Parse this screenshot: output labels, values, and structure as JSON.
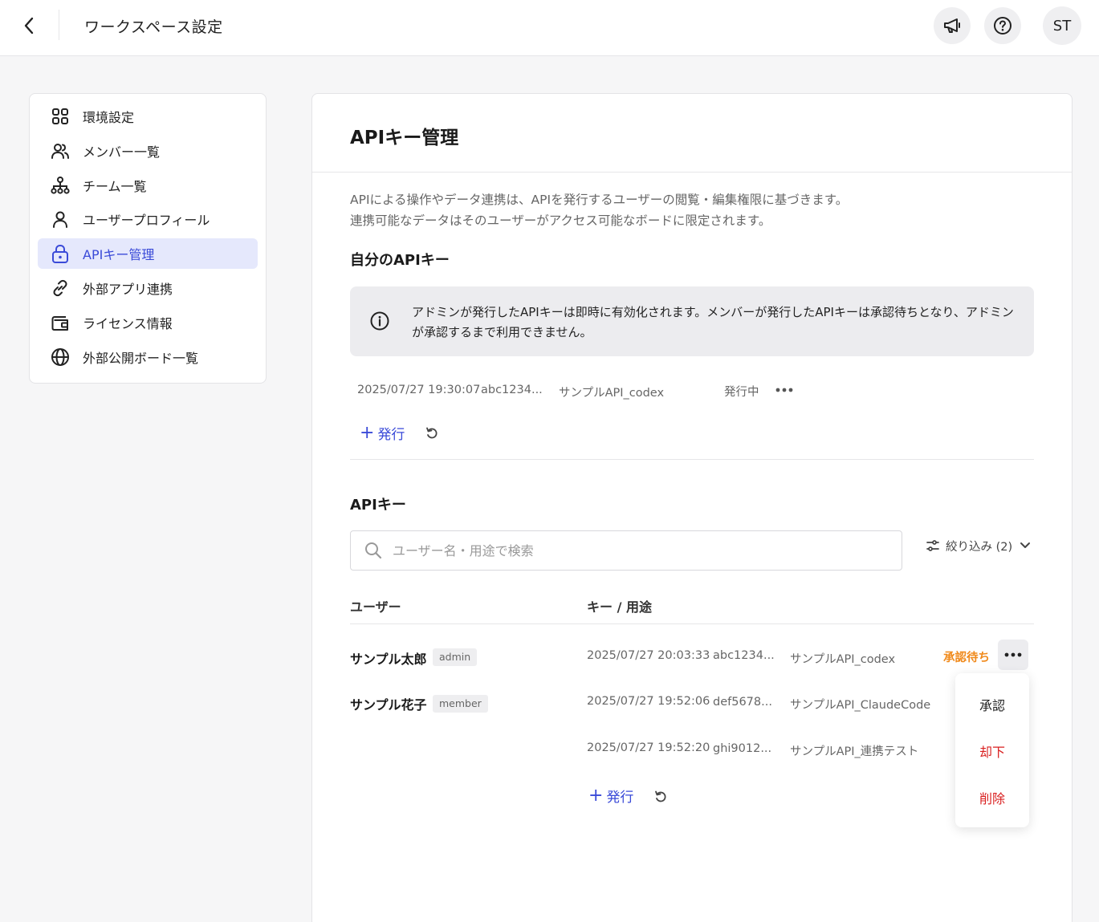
{
  "header": {
    "title": "ワークスペース設定",
    "avatar_initials": "ST"
  },
  "sidebar": {
    "items": [
      {
        "label": "環境設定",
        "icon": "grid-icon"
      },
      {
        "label": "メンバー一覧",
        "icon": "users-icon"
      },
      {
        "label": "チーム一覧",
        "icon": "hierarchy-icon"
      },
      {
        "label": "ユーザープロフィール",
        "icon": "user-icon"
      },
      {
        "label": "APIキー管理",
        "icon": "lock-icon",
        "active": true
      },
      {
        "label": "外部アプリ連携",
        "icon": "link-icon"
      },
      {
        "label": "ライセンス情報",
        "icon": "wallet-icon"
      },
      {
        "label": "外部公開ボード一覧",
        "icon": "globe-icon"
      }
    ]
  },
  "main": {
    "title": "APIキー管理",
    "description_line1": "APIによる操作やデータ連携は、APIを発行するユーザーの閲覧・編集権限に基づきます。",
    "description_line2": "連携可能なデータはそのユーザーがアクセス可能なボードに限定されます。",
    "my_keys": {
      "title": "自分のAPIキー",
      "info": "アドミンが発行したAPIキーは即時に有効化されます。メンバーが発行したAPIキーは承認待ちとなり、アドミンが承認するまで利用できません。",
      "key": {
        "date": "2025/07/27 19:30:07",
        "key": "abc1234...",
        "purpose": "サンプルAPI_codex",
        "status": "発行中"
      },
      "issue_label": "発行"
    },
    "all_keys": {
      "title": "APIキー",
      "search_placeholder": "ユーザー名・用途で検索",
      "filter_label": "絞り込み (2)",
      "columns": {
        "user": "ユーザー",
        "key": "キー / 用途"
      },
      "rows": [
        {
          "user": "サンプル太郎",
          "role": "admin",
          "date": "2025/07/27 20:03:33",
          "key": "abc1234...",
          "purpose": "サンプルAPI_codex",
          "status": "承認待ち"
        },
        {
          "user": "サンプル花子",
          "role": "member",
          "date": "2025/07/27 19:52:06",
          "key": "def5678...",
          "purpose": "サンプルAPI_ClaudeCode"
        },
        {
          "date": "2025/07/27 19:52:20",
          "key": "ghi9012...",
          "purpose": "サンプルAPI_連携テスト"
        }
      ],
      "issue_label": "発行",
      "menu": {
        "approve": "承認",
        "reject": "却下",
        "delete": "削除"
      }
    }
  },
  "colors": {
    "accent": "#3a4ad8",
    "active_bg": "#e5e8fc",
    "pending": "#f08a1c",
    "danger": "#d91f1f"
  }
}
